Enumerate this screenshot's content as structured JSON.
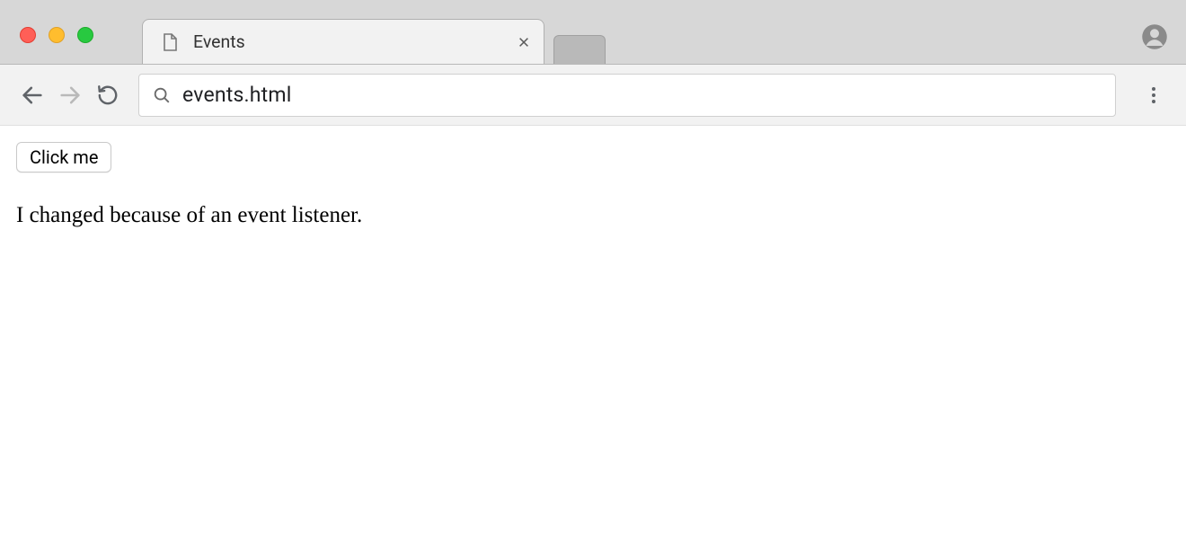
{
  "window": {
    "tab_title": "Events"
  },
  "toolbar": {
    "url": "events.html"
  },
  "page": {
    "button_label": "Click me",
    "paragraph": "I changed because of an event listener."
  }
}
